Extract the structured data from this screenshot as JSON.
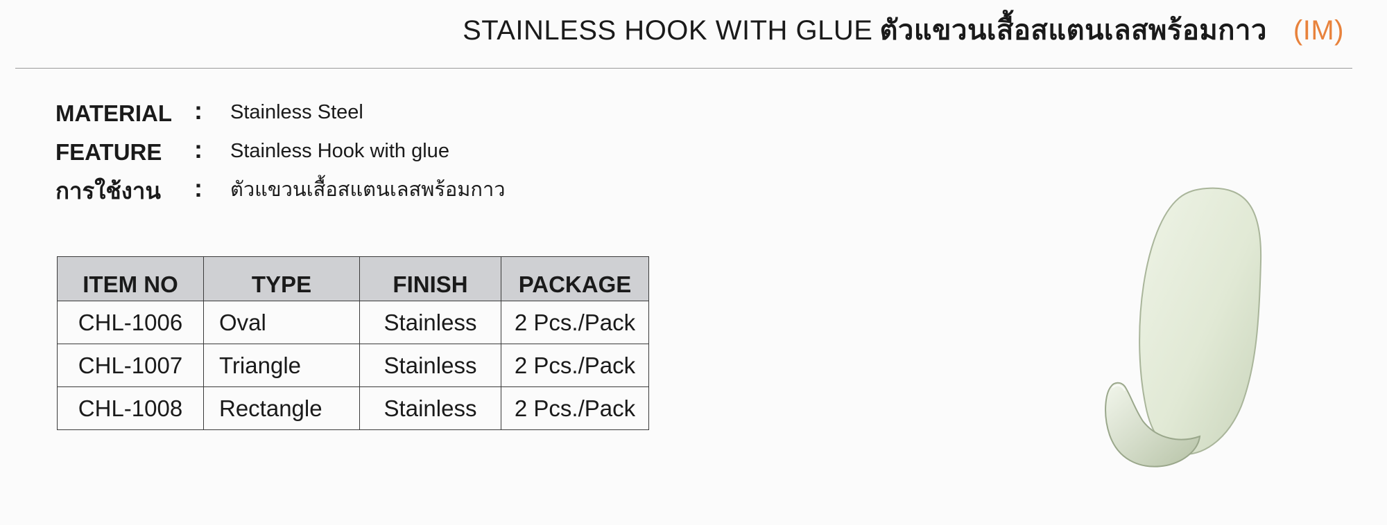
{
  "header": {
    "title_en": "STAINLESS HOOK WITH GLUE",
    "title_th": "ตัวแขวนเสื้อสแตนเลสพร้อมกาว",
    "code": "(IM)",
    "code_color": "#e8823c"
  },
  "specs": [
    {
      "label": "MATERIAL",
      "colon": ":",
      "value": "Stainless Steel"
    },
    {
      "label": "FEATURE",
      "colon": ":",
      "value": "Stainless Hook with glue"
    },
    {
      "label": "การใช้งาน",
      "colon": ":",
      "value": "ตัวแขวนเสื้อสแตนเลสพร้อมกาว"
    }
  ],
  "table": {
    "headers": [
      "ITEM NO",
      "TYPE",
      "FINISH",
      "PACKAGE"
    ],
    "header_bg": "#cfd0d3",
    "rows": [
      [
        "CHL-1006",
        "Oval",
        "Stainless",
        "2 Pcs./Pack"
      ],
      [
        "CHL-1007",
        "Triangle",
        "Stainless",
        "2 Pcs./Pack"
      ],
      [
        "CHL-1008",
        "Rectangle",
        "Stainless",
        "2 Pcs./Pack"
      ]
    ]
  },
  "product_image": {
    "icon": "oval-wall-hook",
    "color": "#e1e9d5"
  }
}
